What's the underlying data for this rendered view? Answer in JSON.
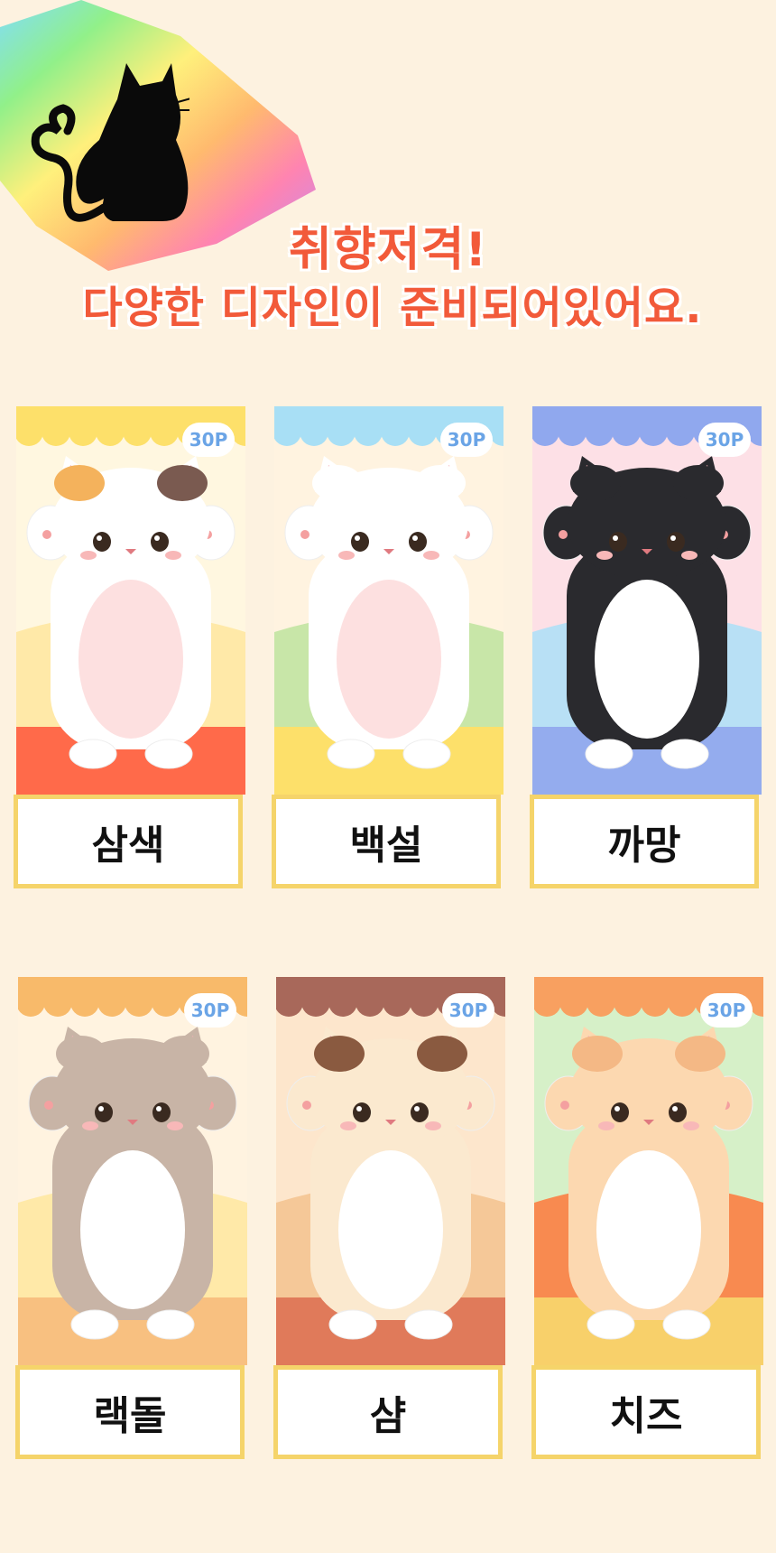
{
  "headline": {
    "line1": "취향저격!",
    "line2": "다양한 디자인이 준비되어있어요."
  },
  "cards": [
    {
      "name": "삼색",
      "badge": "30P",
      "theme": {
        "scallop": "#fde06a",
        "bg": [
          "#fff7e0",
          "#ffe9a8",
          "#ff6a4a"
        ],
        "fur": "#ffffff",
        "belly": "#fde0e0",
        "patch1": "#f4b25c",
        "patch2": "#7a5a50"
      }
    },
    {
      "name": "백설",
      "badge": "30P",
      "theme": {
        "scallop": "#a8dff5",
        "bg": [
          "#fff3e0",
          "#c8e6a8",
          "#fde06a"
        ],
        "fur": "#ffffff",
        "belly": "#fde0e0",
        "patch1": "#ffffff",
        "patch2": "#ffffff"
      }
    },
    {
      "name": "까망",
      "badge": "30P",
      "theme": {
        "scallop": "#90a8ee",
        "bg": [
          "#fde0e6",
          "#b8e0f5",
          "#94acee"
        ],
        "fur": "#2a2a2e",
        "belly": "#ffffff",
        "patch1": "#2a2a2e",
        "patch2": "#2a2a2e"
      }
    },
    {
      "name": "랙돌",
      "badge": "30P",
      "theme": {
        "scallop": "#f8ba6a",
        "bg": [
          "#fff3e0",
          "#ffe9a8",
          "#f8c080"
        ],
        "fur": "#c8b4a6",
        "belly": "#ffffff",
        "patch1": "#c8b4a6",
        "patch2": "#c8b4a6"
      }
    },
    {
      "name": "샴",
      "badge": "30P",
      "theme": {
        "scallop": "#a8685a",
        "bg": [
          "#fde6cc",
          "#f5c898",
          "#e07a5a"
        ],
        "fur": "#fbe9cf",
        "belly": "#ffffff",
        "patch1": "#8a5a40",
        "patch2": "#8a5a40"
      }
    },
    {
      "name": "치즈",
      "badge": "30P",
      "theme": {
        "scallop": "#f8a060",
        "bg": [
          "#d6f0c8",
          "#f88a50",
          "#f8d06a"
        ],
        "fur": "#fcd8b0",
        "belly": "#ffffff",
        "patch1": "#f4b885",
        "patch2": "#f4b885"
      }
    }
  ]
}
